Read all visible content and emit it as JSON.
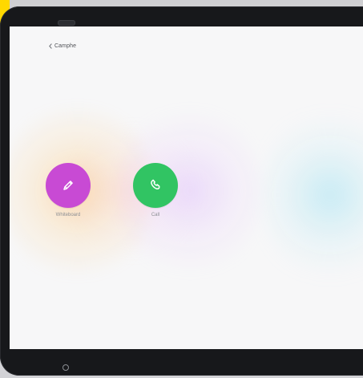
{
  "header": {
    "title": "Camphe"
  },
  "actions": {
    "whiteboard": {
      "label": "Whiteboard",
      "icon": "pencil-icon",
      "color": "#c84ad4"
    },
    "call": {
      "label": "Call",
      "icon": "phone-icon",
      "color": "#31c463"
    }
  },
  "theme": {
    "accent_yellow": "#ffd800",
    "accent_cyan": "#4fc3ea",
    "bezel": "#17181b",
    "screen_bg": "#f7f7f8"
  }
}
